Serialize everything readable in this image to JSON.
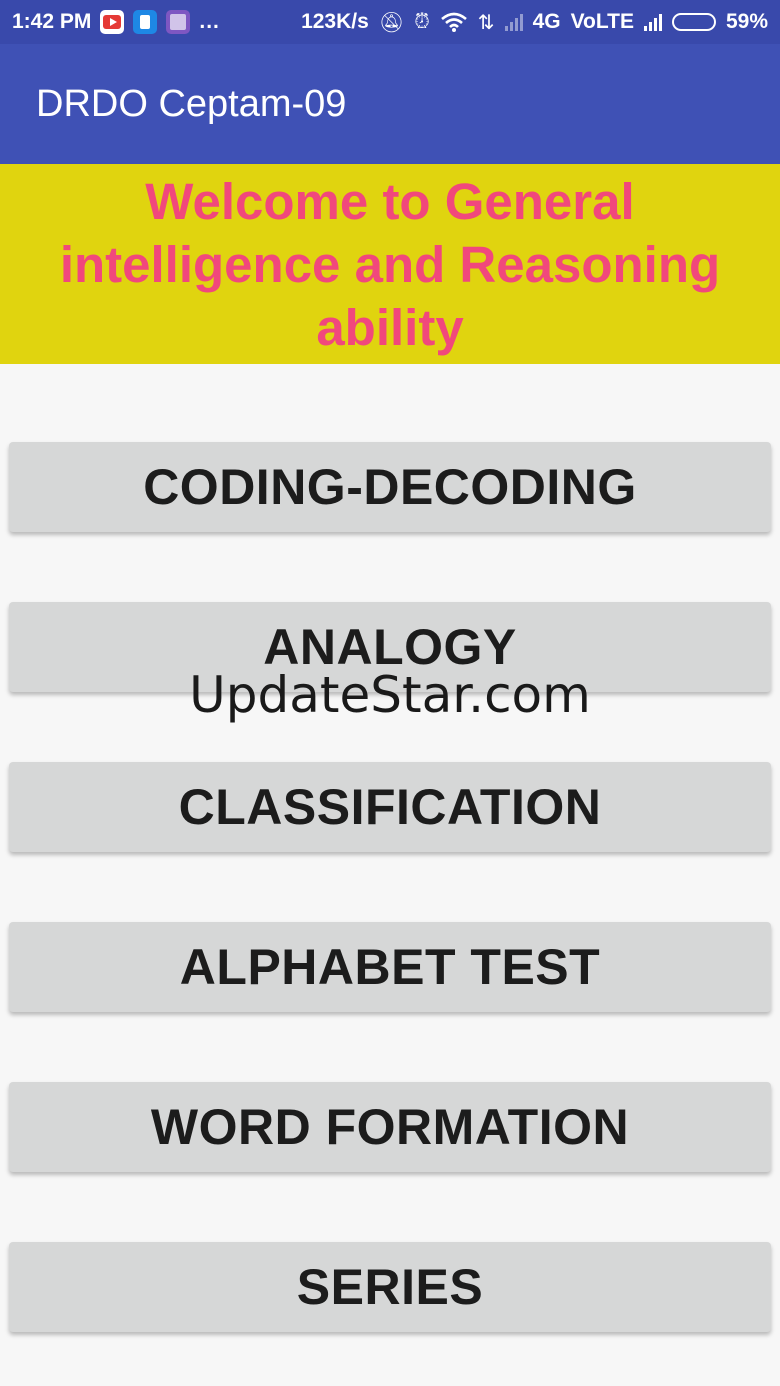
{
  "status_bar": {
    "time": "1:42 PM",
    "notification_icons": [
      "youtube-icon",
      "app-icon",
      "gallery-icon"
    ],
    "more": "...",
    "network_speed": "123K/s",
    "network_type": "4G",
    "volte": "VoLTE",
    "battery_percent": "59%",
    "battery_level": 0.59
  },
  "app_bar": {
    "title": "DRDO Ceptam-09",
    "color": "#3f51b5"
  },
  "banner": {
    "text": "Welcome to General intelligence and Reasoning ability",
    "bg_color": "#e0d40f",
    "text_color": "#f1487c"
  },
  "buttons": [
    {
      "label": "CODING-DECODING"
    },
    {
      "label": "ANALOGY"
    },
    {
      "label": "CLASSIFICATION"
    },
    {
      "label": "ALPHABET TEST"
    },
    {
      "label": "WORD FORMATION"
    },
    {
      "label": "SERIES"
    }
  ],
  "watermark": "UpdateStar.com"
}
